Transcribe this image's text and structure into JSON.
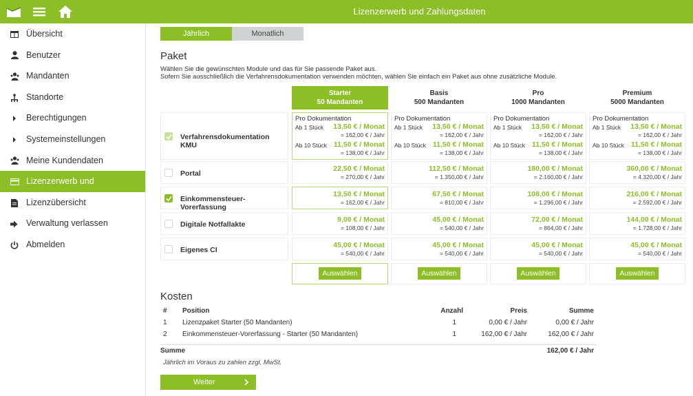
{
  "header": {
    "title": "Lizenzerwerb und Zahlungsdaten"
  },
  "sidebar": {
    "items": [
      {
        "label": "Übersicht",
        "icon": "table-icon"
      },
      {
        "label": "Benutzer",
        "icon": "user-icon"
      },
      {
        "label": "Mandanten",
        "icon": "users-icon"
      },
      {
        "label": "Standorte",
        "icon": "sitemap-icon"
      },
      {
        "label": "Berechtigungen",
        "icon": "chevron-right-icon"
      },
      {
        "label": "Systemeinstellungen",
        "icon": "chevron-right-icon"
      },
      {
        "label": "Meine Kundendaten",
        "icon": "users-icon"
      },
      {
        "label": "Lizenzerwerb und Zahlungsdaten",
        "icon": "credit-card-icon"
      },
      {
        "label": "Lizenzübersicht",
        "icon": "document-icon"
      },
      {
        "label": "Verwaltung verlassen",
        "icon": "sign-out-icon"
      },
      {
        "label": "Abmelden",
        "icon": "power-icon"
      }
    ]
  },
  "billing": {
    "yearly": "Jährlich",
    "monthly": "Monatlich"
  },
  "paket": {
    "title": "Paket",
    "intro1": "Wählen Sie die gewünschten Module und das für Sie passende Paket aus.",
    "intro2": "Sofern Sie ausschließlich die Verfahrensdokumentation verwenden möchten, wählen Sie einfach ein Paket aus ohne zusätzliche Module.",
    "plans": [
      {
        "name": "Starter",
        "clients": "50 Mandanten"
      },
      {
        "name": "Basis",
        "clients": "500 Mandanten"
      },
      {
        "name": "Pro",
        "clients": "1000 Mandanten"
      },
      {
        "name": "Premium",
        "clients": "5000 Mandanten"
      }
    ],
    "vd": {
      "label": "Verfahrensdokumentation KMU",
      "doc": "Pro Dokumentation",
      "tier1": "Ab 1 Stück",
      "tier2": "Ab 10 Stück",
      "price1": "13,50 € / Monat",
      "year1": "= 162,00 € / Jahr",
      "price2": "11,50 € / Monat",
      "year2": "= 138,00 € / Jahr"
    },
    "modules": [
      {
        "label": "Portal",
        "checked": false,
        "prices": [
          [
            "22,50 € / Monat",
            "= 270,00 € / Jahr"
          ],
          [
            "112,50 € / Monat",
            "= 1.350,00 € / Jahr"
          ],
          [
            "180,00 € / Monat",
            "= 2.160,00 € / Jahr"
          ],
          [
            "360,00 € / Monat",
            "= 4.320,00 € / Jahr"
          ]
        ]
      },
      {
        "label": "Einkommensteuer-Vorerfassung",
        "checked": true,
        "prices": [
          [
            "13,50 € / Monat",
            "= 162,00 € / Jahr"
          ],
          [
            "67,50 € / Monat",
            "= 810,00 € / Jahr"
          ],
          [
            "108,00 € / Monat",
            "= 1.296,00 € / Jahr"
          ],
          [
            "216,00 € / Monat",
            "= 2.592,00 € / Jahr"
          ]
        ]
      },
      {
        "label": "Digitale Notfallakte",
        "checked": false,
        "prices": [
          [
            "9,00 € / Monat",
            "= 108,00 € / Jahr"
          ],
          [
            "45,00 € / Monat",
            "= 540,00 € / Jahr"
          ],
          [
            "72,00 € / Monat",
            "= 864,00 € / Jahr"
          ],
          [
            "144,00 € / Monat",
            "= 1.728,00 € / Jahr"
          ]
        ]
      },
      {
        "label": "Eigenes CI",
        "checked": false,
        "prices": [
          [
            "45,00 € / Monat",
            "= 540,00 € / Jahr"
          ],
          [
            "45,00 € / Monat",
            "= 540,00 € / Jahr"
          ],
          [
            "45,00 € / Monat",
            "= 540,00 € / Jahr"
          ],
          [
            "45,00 € / Monat",
            "= 540,00 € / Jahr"
          ]
        ]
      }
    ],
    "select_label": "Auswählen"
  },
  "kosten": {
    "title": "Kosten",
    "headers": {
      "nr": "#",
      "position": "Position",
      "anzahl": "Anzahl",
      "preis": "Preis",
      "summe": "Summe"
    },
    "rows": [
      {
        "nr": "1",
        "position": "Lizenzpaket Starter (50 Mandanten)",
        "anzahl": "1",
        "preis": "0,00 € / Jahr",
        "summe": "0,00 € / Jahr"
      },
      {
        "nr": "2",
        "position": "Einkommensteuer-Vorerfassung - Starter (50 Mandanten)",
        "anzahl": "1",
        "preis": "162,00 € / Jahr",
        "summe": "162,00 € / Jahr"
      }
    ],
    "sum_label": "Summe",
    "sum_value": "162,00 € / Jahr",
    "note": "Jährlich im Voraus zu zahlen zzgl. MwSt.",
    "next_label": "Weiter"
  }
}
